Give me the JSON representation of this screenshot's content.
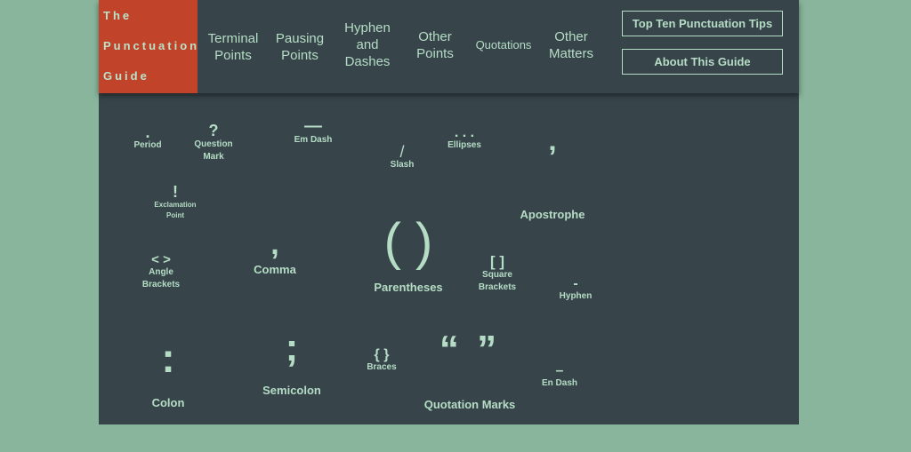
{
  "logo": {
    "line1": "The",
    "line2": "Punctuation",
    "line3": "Guide"
  },
  "nav": [
    "Terminal Points",
    "Pausing Points",
    "Hyphen and Dashes",
    "Other Points",
    "Quotations",
    "Other Matters"
  ],
  "buttons": {
    "tips": "Top Ten Punctuation Tips",
    "about": "About This Guide"
  },
  "items": [
    {
      "glyph": ".",
      "label": "Period"
    },
    {
      "glyph": "?",
      "label": "Question Mark"
    },
    {
      "glyph": "—",
      "label": "Em Dash"
    },
    {
      "glyph": "/",
      "label": "Slash"
    },
    {
      "glyph": ". . .",
      "label": "Ellipses"
    },
    {
      "glyph": "’",
      "label": "Apostrophe"
    },
    {
      "glyph": "!",
      "label": "Exclamation Point"
    },
    {
      "glyph": "< >",
      "label": "Angle Brackets"
    },
    {
      "glyph": ",",
      "label": "Comma"
    },
    {
      "glyph": "( )",
      "label": "Parentheses"
    },
    {
      "glyph": "[ ]",
      "label": "Square Brackets"
    },
    {
      "glyph": "-",
      "label": "Hyphen"
    },
    {
      "glyph": ":",
      "label": "Colon"
    },
    {
      "glyph": ";",
      "label": "Semicolon"
    },
    {
      "glyph": "{ }",
      "label": "Braces"
    },
    {
      "glyph": "“ ”",
      "label": "Quotation Marks"
    },
    {
      "glyph": "–",
      "label": "En Dash"
    }
  ],
  "colors": {
    "background": "#88b59c",
    "panel": "#37454b",
    "accent": "#c1432a",
    "text": "#b5dcc4"
  }
}
